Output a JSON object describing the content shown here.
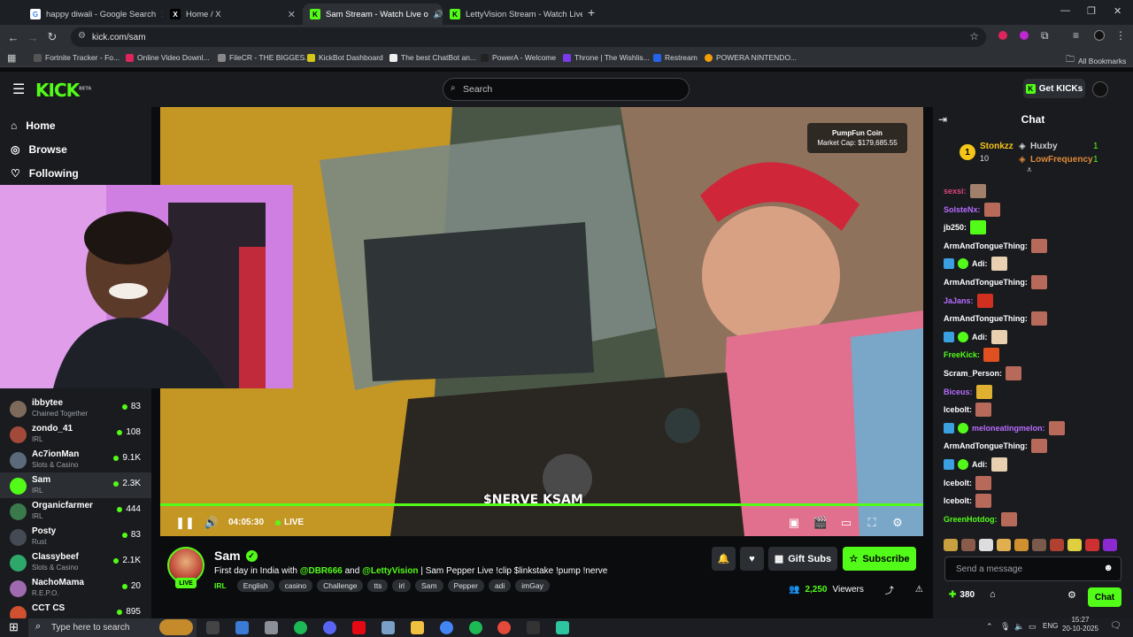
{
  "browser": {
    "tabs": [
      {
        "title": "happy diwali - Google Search",
        "favicon": "google-icon",
        "color": "#ffffff",
        "active": false
      },
      {
        "title": "Home / X",
        "favicon": "x-icon",
        "color": "#ffffff",
        "active": false
      },
      {
        "title": "Sam Stream - Watch Live o",
        "favicon": "kick-icon",
        "color": "#53fc18",
        "active": true
      },
      {
        "title": "LettyVision Stream - Watch Live",
        "favicon": "kick-icon",
        "color": "#53fc18",
        "active": false
      }
    ],
    "new_tab": "+",
    "url": "kick.com/sam",
    "bookmarks": [
      "Fortnite Tracker - Fo...",
      "Online Video Downl...",
      "FileCR - THE BIGGES...",
      "KickBot Dashboard",
      "The best ChatBot an...",
      "PowerA - Welcome",
      "Throne | The Wishlis...",
      "Restream",
      "POWERA NINTENDO..."
    ],
    "all_bookmarks": "All Bookmarks"
  },
  "kick": {
    "logo": "KICK",
    "logo_beta": "BETA",
    "search_placeholder": "Search",
    "get_kicks": "Get KICKs"
  },
  "sidebar": {
    "nav": [
      {
        "label": "Home",
        "icon": "home-icon"
      },
      {
        "label": "Browse",
        "icon": "browse-icon"
      },
      {
        "label": "Following",
        "icon": "heart-icon"
      }
    ],
    "channels": [
      {
        "name": "ibbytee",
        "category": "Chained Together",
        "viewers": "83",
        "color": "#7d6a5a"
      },
      {
        "name": "zondo_41",
        "category": "IRL",
        "viewers": "108",
        "color": "#a14a3a"
      },
      {
        "name": "Ac7ionMan",
        "category": "Slots & Casino",
        "viewers": "9.1K",
        "color": "#5b6a7a"
      },
      {
        "name": "Sam",
        "category": "IRL",
        "viewers": "2.3K",
        "color": "#53fc18"
      },
      {
        "name": "Organicfarmer",
        "category": "IRL",
        "viewers": "444",
        "color": "#3a7a4a"
      },
      {
        "name": "Posty",
        "category": "Rust",
        "viewers": "83",
        "color": "#444b55"
      },
      {
        "name": "Classybeef",
        "category": "Slots & Casino",
        "viewers": "2.1K",
        "color": "#2ea86a"
      },
      {
        "name": "NachoMama",
        "category": "R.E.P.O.",
        "viewers": "20",
        "color": "#a06ab0"
      },
      {
        "name": "CCT CS",
        "category": "",
        "viewers": "895",
        "color": "#d05030"
      }
    ]
  },
  "player": {
    "pumpfun_title": "PumpFun Coin",
    "pumpfun_cap": "Market Cap: $179,685.55",
    "overlay_text": "$NERVE KSAM",
    "time": "04:05:30",
    "live_label": "LIVE",
    "progress": 1.0
  },
  "stream": {
    "streamer": "Sam",
    "live_badge": "LIVE",
    "title_prefix": "First day in India with",
    "mention1": "@DBR666",
    "title_and": "and",
    "mention2": "@LettyVision",
    "title_suffix": "| Sam Pepper Live !clip $linkstake !pump !nerve",
    "category": "IRL",
    "tags": [
      "English",
      "casino",
      "Challenge",
      "tts",
      "irl",
      "Sam",
      "Pepper",
      "adi",
      "imGay"
    ],
    "gift_subs": "Gift Subs",
    "subscribe": "Subscribe",
    "viewers": "2,250",
    "viewers_label": "Viewers"
  },
  "chat": {
    "header": "Chat",
    "leaderboard": {
      "rank": "1",
      "top_user": "Stonkzz",
      "top_count": "10",
      "second_user": "Huxby",
      "second_count": "1",
      "third_user": "LowFrequency",
      "third_count": "1"
    },
    "messages": [
      {
        "user": "sexsi:",
        "color": "#e0457b"
      },
      {
        "user": "SolsteNx:",
        "color": "#b86cff"
      },
      {
        "user": "jb250:",
        "color": "#ffffff"
      },
      {
        "user": "ArmAndTongueThing:",
        "color": "#ffffff"
      },
      {
        "user": "Adi:",
        "color": "#ffffff"
      },
      {
        "user": "ArmAndTongueThing:",
        "color": "#ffffff"
      },
      {
        "user": "JaJans:",
        "color": "#b86cff"
      },
      {
        "user": "ArmAndTongueThing:",
        "color": "#ffffff"
      },
      {
        "user": "Adi:",
        "color": "#ffffff"
      },
      {
        "user": "FreeKick:",
        "color": "#53fc18"
      },
      {
        "user": "Scram_Person:",
        "color": "#ffffff"
      },
      {
        "user": "Biceus:",
        "color": "#b86cff"
      },
      {
        "user": "Icebolt:",
        "color": "#ffffff"
      },
      {
        "user": "meloneatingmelon:",
        "color": "#b86cff"
      },
      {
        "user": "ArmAndTongueThing:",
        "color": "#ffffff"
      },
      {
        "user": "Adi:",
        "color": "#ffffff"
      },
      {
        "user": "Icebolt:",
        "color": "#ffffff"
      },
      {
        "user": "Icebolt:",
        "color": "#ffffff"
      },
      {
        "user": "GreenHotdog:",
        "color": "#53fc18"
      }
    ],
    "placeholder": "Send a message",
    "points": "380",
    "chat_button": "Chat"
  },
  "taskbar": {
    "search_placeholder": "Type here to search",
    "lang": "ENG",
    "time": "15:27",
    "date": "20-10-2025"
  },
  "colors": {
    "accent": "#53fc18",
    "bg": "#0b0c0e",
    "panel": "#191b1f"
  }
}
